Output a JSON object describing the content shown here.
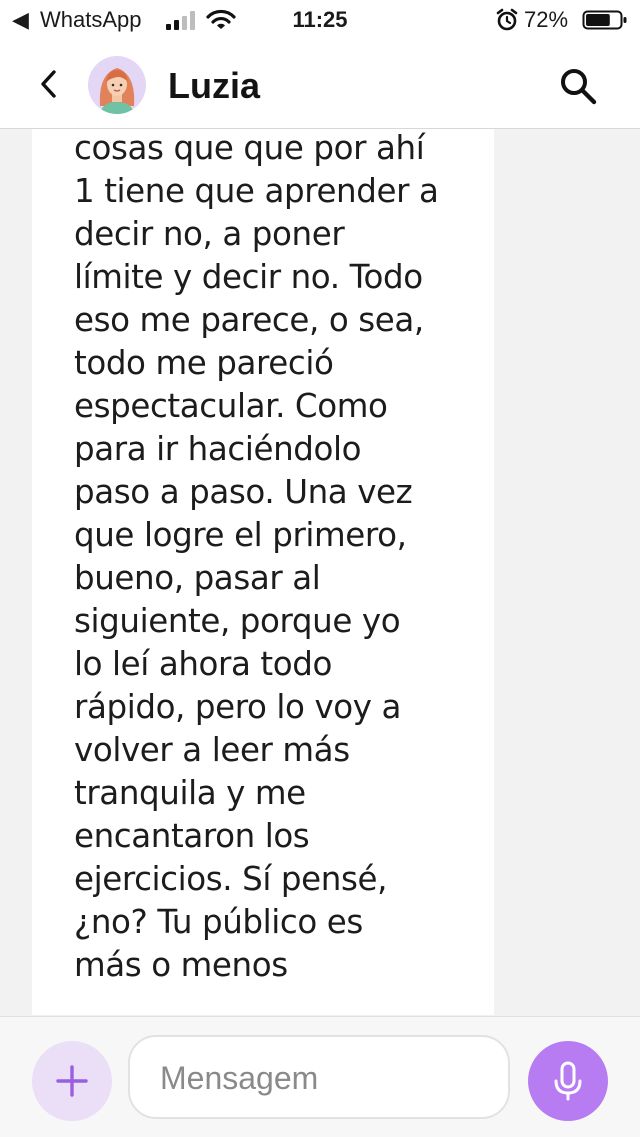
{
  "status_bar": {
    "back_glyph": "◀",
    "app_label": "WhatsApp",
    "time": "11:25",
    "battery_percent": "72%",
    "battery_level": 0.72,
    "signal_bars_filled": 2,
    "icons": [
      "signal-icon",
      "wifi-icon",
      "alarm-icon",
      "battery-icon"
    ]
  },
  "header": {
    "contact_name": "Luzia",
    "icons": [
      "chevron-left-icon",
      "avatar",
      "search-icon"
    ]
  },
  "message": {
    "text": "también\nsobrecargarse con\ncosas que que por ahí\n1 tiene que aprender a\ndecir no, a poner\nlímite y decir no. Todo\neso me parece, o sea,\ntodo me pareció\nespectacular. Como\npara ir haciéndolo\npaso a paso. Una vez\nque logre el primero,\nbueno, pasar al\nsiguiente, porque yo\nlo leí ahora todo\nrápido, pero lo voy a\nvolver a leer más\ntranquila y me\nencantaron los\nejercicios. Sí pensé,\n¿no? Tu público es\nmás o menos"
  },
  "input_bar": {
    "placeholder": "Mensagem",
    "icons": [
      "plus-icon",
      "microphone-icon"
    ]
  },
  "colors": {
    "accent": "#b77cf2",
    "accent_light": "#eadff7",
    "background": "#f2f2f2"
  }
}
